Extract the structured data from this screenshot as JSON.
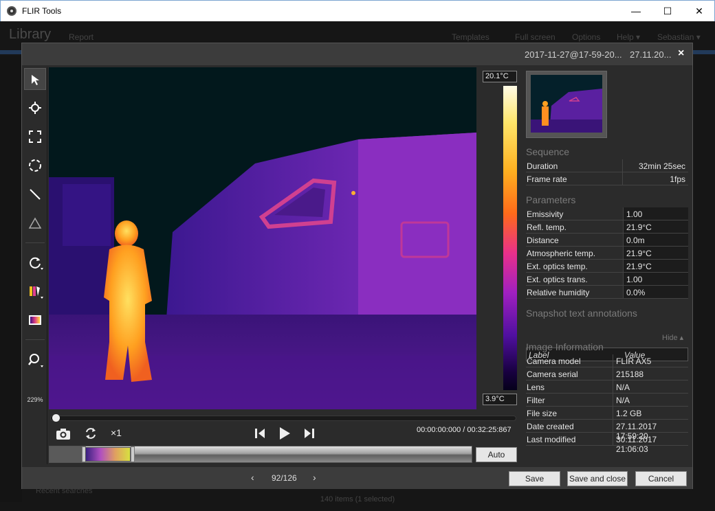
{
  "window": {
    "title": "FLIR Tools",
    "minimize": "—",
    "maximize": "☐",
    "close": "✕"
  },
  "library": {
    "title": "Library",
    "report": "Report",
    "nav": [
      "Templates",
      "Full screen",
      "Options",
      "Help ▾",
      "Sebastian ▾"
    ],
    "footer": "140 items  (1 selected)",
    "recent": "Recent searches"
  },
  "dialog": {
    "filename": "2017-11-27@17-59-20...",
    "date": "27.11.20...",
    "close": "×"
  },
  "toolbar": {
    "zoom": "229%",
    "tools": [
      "select-pointer",
      "spot-crosshair",
      "box-area",
      "circle-area",
      "line",
      "delta",
      "rotate",
      "palette",
      "color-scale",
      "zoom"
    ]
  },
  "colorscale": {
    "max": "20.1°C",
    "min": "3.9°C"
  },
  "playback": {
    "speed": "×1",
    "time": "00:00:00:000 / 00:32:25:867",
    "progress": 0.0
  },
  "histogram": {
    "auto_label": "Auto"
  },
  "sequence": {
    "title": "Sequence",
    "rows": [
      {
        "key": "Duration",
        "value": "32min 25sec"
      },
      {
        "key": "Frame rate",
        "value": "1fps"
      }
    ]
  },
  "parameters": {
    "title": "Parameters",
    "rows": [
      {
        "key": "Emissivity",
        "value": "1.00"
      },
      {
        "key": "Refl. temp.",
        "value": "21.9°C"
      },
      {
        "key": "Distance",
        "value": "0.0m"
      },
      {
        "key": "Atmospheric temp.",
        "value": "21.9°C"
      },
      {
        "key": "Ext. optics temp.",
        "value": "21.9°C"
      },
      {
        "key": "Ext. optics trans.",
        "value": "1.00"
      },
      {
        "key": "Relative humidity",
        "value": "0.0%"
      }
    ],
    "hide": "Hide ▴"
  },
  "annotations": {
    "title": "Snapshot text annotations",
    "col_label": "Label",
    "col_value": "Value"
  },
  "image_info": {
    "title": "Image Information",
    "rows": [
      {
        "key": "Camera model",
        "value": "FLIR AX5"
      },
      {
        "key": "Camera serial",
        "value": "215188"
      },
      {
        "key": "Lens",
        "value": "N/A"
      },
      {
        "key": "Filter",
        "value": "N/A"
      },
      {
        "key": "File size",
        "value": "1.2 GB"
      },
      {
        "key": "Date created",
        "value": "27.11.2017 17:59:20"
      },
      {
        "key": "Last modified",
        "value": "30.11.2017 21:06:03"
      }
    ]
  },
  "footer": {
    "prev": "‹",
    "next": "›",
    "page": "92/126",
    "save": "Save",
    "save_close": "Save and close",
    "cancel": "Cancel"
  }
}
